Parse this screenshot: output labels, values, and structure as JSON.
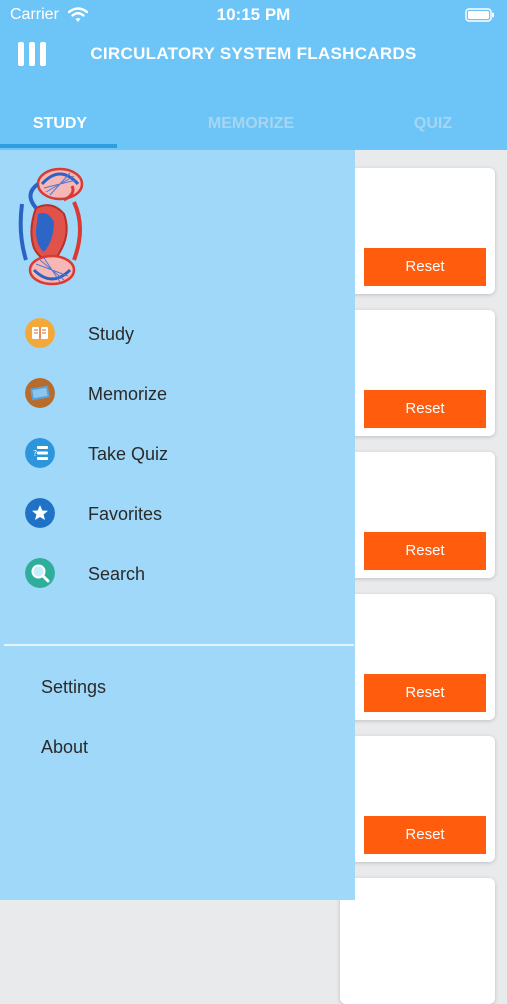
{
  "status_bar": {
    "carrier": "Carrier",
    "time": "10:15 PM"
  },
  "header": {
    "title": "CIRCULATORY SYSTEM FLASHCARDS"
  },
  "tabs": [
    {
      "label": "STUDY",
      "active": true
    },
    {
      "label": "MEMORIZE",
      "active": false
    },
    {
      "label": "QUIZ",
      "active": false
    }
  ],
  "cards": [
    {
      "button": "Reset"
    },
    {
      "button": "Reset"
    },
    {
      "button": "Reset"
    },
    {
      "button": "Reset"
    },
    {
      "button": "Reset"
    }
  ],
  "drawer": {
    "logo_icon": "heart-circulation-icon",
    "menu": [
      {
        "label": "Study",
        "icon": "book-icon"
      },
      {
        "label": "Memorize",
        "icon": "flashcard-icon"
      },
      {
        "label": "Take Quiz",
        "icon": "quiz-list-icon"
      },
      {
        "label": "Favorites",
        "icon": "star-icon"
      },
      {
        "label": "Search",
        "icon": "search-icon"
      }
    ],
    "secondary": [
      {
        "label": "Settings"
      },
      {
        "label": "About"
      }
    ]
  },
  "colors": {
    "header": "#6cc4f7",
    "drawer": "#9fd8f8",
    "reset_button": "#ff5d0d",
    "tab_indicator": "#2f9ee0"
  }
}
